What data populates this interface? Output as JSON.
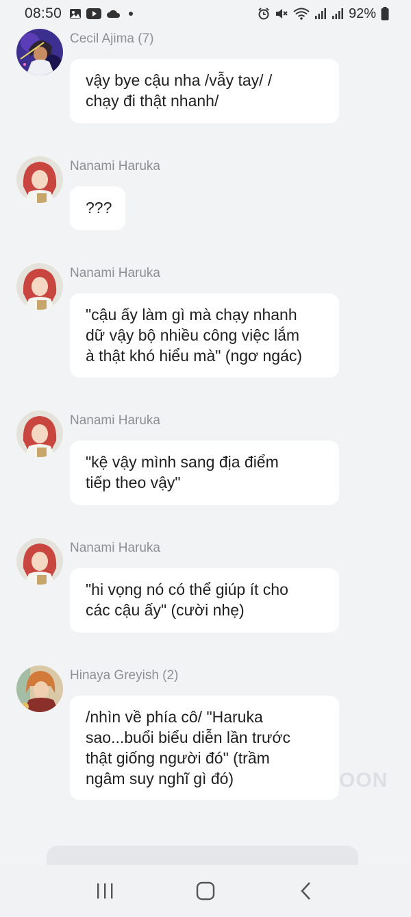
{
  "status_bar": {
    "time": "08:50",
    "battery": "92%",
    "icons_left": [
      "gallery-icon",
      "youtube-icon",
      "cloud-icon",
      "dot-icon"
    ],
    "icons_right": [
      "alarm-icon",
      "mute-icon",
      "wifi-icon",
      "signal-icon",
      "signal-icon",
      "battery-icon"
    ]
  },
  "messages": [
    {
      "sender": "Cecil Ajima (7)",
      "lines": [
        "vậy bye cậu nha /vẫy tay/ /",
        "chạy đi thật nhanh/"
      ]
    },
    {
      "sender": "Nanami Haruka",
      "lines": [
        "???"
      ]
    },
    {
      "sender": "Nanami Haruka",
      "lines": [
        "\"cậu ấy làm gì mà chạy nhanh",
        "dữ vậy bộ nhiều công việc lắm",
        "à thật khó hiểu mà\" (ngơ ngác)"
      ]
    },
    {
      "sender": "Nanami Haruka",
      "lines": [
        "\"kệ vậy mình sang địa điểm",
        "tiếp theo vậy\""
      ]
    },
    {
      "sender": "Nanami Haruka",
      "lines": [
        "\"hi vọng nó có thể giúp ít cho",
        "các cậu ấy\" (cười nhẹ)"
      ]
    },
    {
      "sender": "Hinaya Greyish (2)",
      "lines": [
        "/nhìn về phía cô/ \"Haruka",
        "sao...buổi biểu diễn lần trước",
        "thật giống người đó\" (trầm",
        "ngâm suy nghĩ gì đó)"
      ]
    }
  ],
  "watermark": "OON",
  "colors": {
    "background": "#f2f3f5",
    "bubble": "#ffffff",
    "sender_text": "#8c8f94",
    "message_text": "#1f1f1f",
    "haruka_hair": "#c9453f",
    "cecil_hair": "#2c2430",
    "hinaya_hair": "#d27a3a"
  },
  "nav_bar": {
    "buttons": [
      "recent-apps-icon",
      "home-icon",
      "back-icon"
    ]
  }
}
